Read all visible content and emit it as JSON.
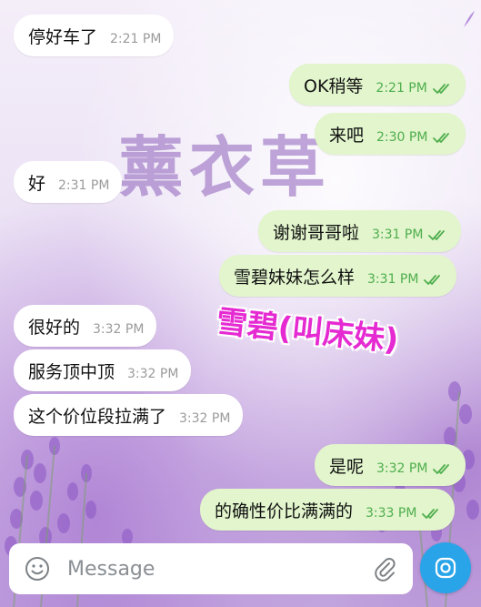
{
  "watermark_text": "薰衣草",
  "overlay_caption": "雪碧(叫床妹)",
  "messages": [
    {
      "text": "停好车了",
      "time": "2:21 PM",
      "direction": "in"
    },
    {
      "text": "OK稍等",
      "time": "2:21 PM",
      "direction": "out",
      "read": true
    },
    {
      "text": "来吧",
      "time": "2:30 PM",
      "direction": "out",
      "read": true
    },
    {
      "text": "好",
      "time": "2:31 PM",
      "direction": "in"
    },
    {
      "text": "谢谢哥哥啦",
      "time": "3:31 PM",
      "direction": "out",
      "read": true
    },
    {
      "text": "雪碧妹妹怎么样",
      "time": "3:31 PM",
      "direction": "out",
      "read": true
    },
    {
      "text": "很好的",
      "time": "3:32 PM",
      "direction": "in"
    },
    {
      "text": "服务顶中顶",
      "time": "3:32 PM",
      "direction": "in"
    },
    {
      "text": "这个价位段拉满了",
      "time": "3:32 PM",
      "direction": "in"
    },
    {
      "text": "是呢",
      "time": "3:32 PM",
      "direction": "out",
      "read": true
    },
    {
      "text": "的确性价比满满的",
      "time": "3:33 PM",
      "direction": "out",
      "read": true
    }
  ],
  "composer": {
    "placeholder": "Message",
    "emoji_icon": "emoji-icon",
    "attach_icon": "paperclip-icon",
    "camera_icon": "camera-icon"
  },
  "colors": {
    "incoming_bubble": "#ffffff",
    "outgoing_bubble": "#e2f5cc",
    "read_ticks": "#4fae4e",
    "send_button": "#2aa4e9",
    "caption": "#e52ad2"
  }
}
